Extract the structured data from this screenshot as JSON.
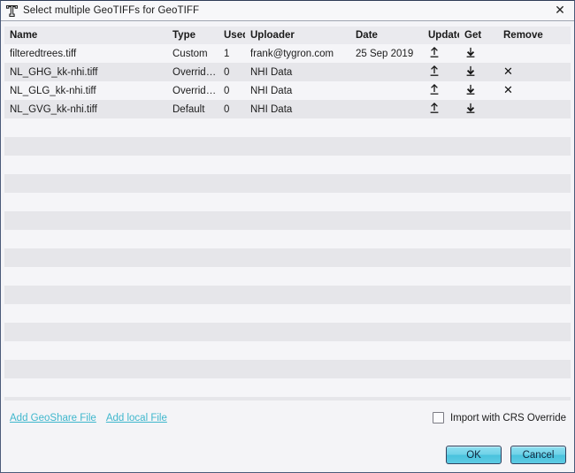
{
  "window": {
    "title": "Select multiple GeoTIFFs for GeoTIFF",
    "app_icon": "tygron-logo-icon",
    "close_icon": "✕"
  },
  "table": {
    "columns": [
      {
        "key": "name",
        "label": "Name"
      },
      {
        "key": "type",
        "label": "Type"
      },
      {
        "key": "used",
        "label": "Used"
      },
      {
        "key": "uploader",
        "label": "Uploader"
      },
      {
        "key": "date",
        "label": "Date"
      },
      {
        "key": "update",
        "label": "Update"
      },
      {
        "key": "get",
        "label": "Get"
      },
      {
        "key": "remove",
        "label": "Remove"
      }
    ],
    "rows": [
      {
        "name": "filteredtrees.tiff",
        "type": "Custom",
        "used": "1",
        "uploader": "frank@tygron.com",
        "date": "25 Sep 2019",
        "update": true,
        "get": true,
        "remove": false
      },
      {
        "name": "NL_GHG_kk-nhi.tiff",
        "type": "Override De...",
        "used": "0",
        "uploader": "NHI Data",
        "date": "",
        "update": true,
        "get": true,
        "remove": true
      },
      {
        "name": "NL_GLG_kk-nhi.tiff",
        "type": "Override De...",
        "used": "0",
        "uploader": "NHI Data",
        "date": "",
        "update": true,
        "get": true,
        "remove": true
      },
      {
        "name": "NL_GVG_kk-nhi.tiff",
        "type": "Default",
        "used": "0",
        "uploader": "NHI Data",
        "date": "",
        "update": true,
        "get": true,
        "remove": false
      }
    ],
    "empty_row_count": 17,
    "icons": {
      "update": "upload-icon",
      "get": "download-icon",
      "remove": "close-x-icon"
    }
  },
  "footer": {
    "add_geoshare_file": "Add GeoShare File",
    "add_local_file": "Add local File",
    "crs_checkbox_label": "Import with CRS Override",
    "crs_checked": false,
    "ok_label": "OK",
    "cancel_label": "Cancel"
  },
  "colors": {
    "link": "#3fb7cd",
    "button_accent": "#5ecbe4",
    "button_border": "#33415e",
    "header_bg": "#eaeaee",
    "row_odd": "#f5f5f8",
    "row_even": "#e6e6ea",
    "dialog_bg": "#f4f4f7"
  }
}
